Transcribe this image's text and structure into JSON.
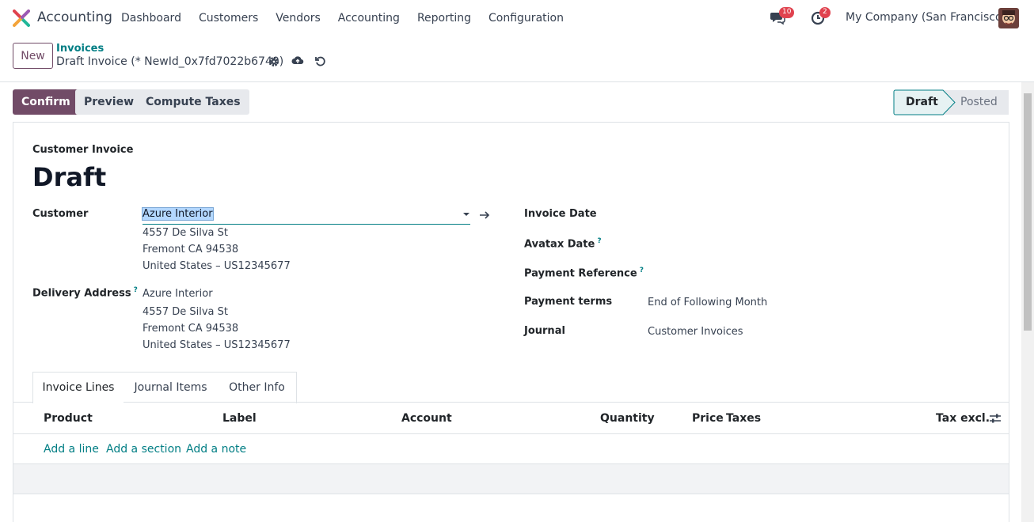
{
  "navbar": {
    "app_name": "Accounting",
    "menu": [
      "Dashboard",
      "Customers",
      "Vendors",
      "Accounting",
      "Reporting",
      "Configuration"
    ],
    "messages_count": "10",
    "activities_count": "2",
    "company": "My Company (San Francisco)"
  },
  "control": {
    "new_label": "New",
    "breadcrumb": "Invoices",
    "record_title": "Draft Invoice (* NewId_0x7fd7022b6740)"
  },
  "statusbar": {
    "confirm": "Confirm",
    "preview": "Preview",
    "compute_taxes": "Compute Taxes",
    "stages": [
      "Draft",
      "Posted"
    ],
    "active_stage": "Draft"
  },
  "form": {
    "type_label": "Customer Invoice",
    "title": "Draft",
    "customer_label": "Customer",
    "customer_value": "Azure Interior",
    "customer_address": [
      "4557 De Silva St",
      "Fremont CA 94538",
      "United States – US12345677"
    ],
    "delivery_label": "Delivery Address",
    "delivery_value": "Azure Interior",
    "delivery_address": [
      "4557 De Silva St",
      "Fremont CA 94538",
      "United States – US12345677"
    ],
    "invoice_date_label": "Invoice Date",
    "avatax_date_label": "Avatax Date",
    "payment_ref_label": "Payment Reference",
    "payment_terms_label": "Payment terms",
    "payment_terms_value": "End of Following Month",
    "journal_label": "Journal",
    "journal_value": "Customer Invoices",
    "help_mark": "?"
  },
  "tabs": [
    "Invoice Lines",
    "Journal Items",
    "Other Info"
  ],
  "table": {
    "columns": [
      "Product",
      "Label",
      "Account",
      "Quantity",
      "Price",
      "Taxes",
      "Tax excl."
    ],
    "add_links": [
      "Add a line",
      "Add a section",
      "Add a note"
    ]
  },
  "colors": {
    "primary": "#714b67",
    "link": "#017e84",
    "badge": "#e0424e"
  }
}
